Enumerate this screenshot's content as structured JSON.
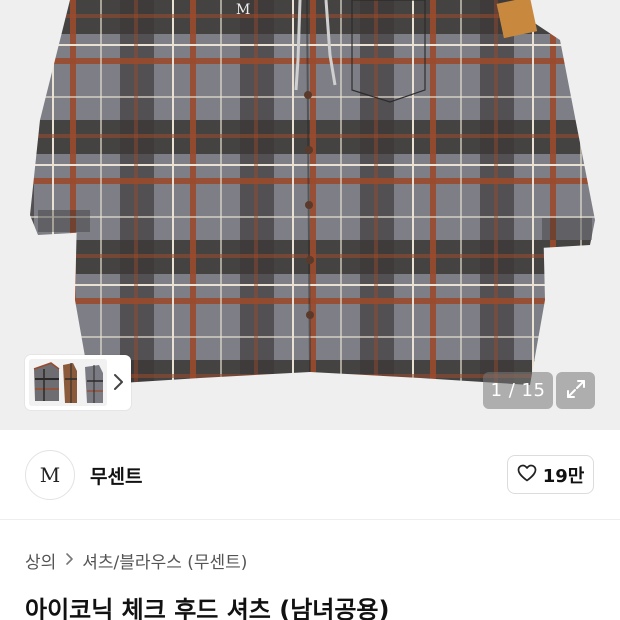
{
  "gallery": {
    "counter": "1 / 15",
    "thumbnail_icon": "shirt-thumbnail",
    "next_icon": "chevron-right-icon",
    "expand_icon": "expand-icon"
  },
  "store": {
    "logo_text": "M",
    "name": "무센트",
    "like_icon": "heart-icon",
    "like_count": "19만"
  },
  "breadcrumb": {
    "items": [
      "상의",
      "셔츠/블라우스 (무센트)"
    ],
    "separator_icon": "chevron-right-icon"
  },
  "product": {
    "title": "아이코닉 체크 후드 셔츠 (남녀공용)"
  },
  "colors": {
    "plaid_gray": "#7e7f86",
    "plaid_dark": "#2c2a28",
    "plaid_rust": "#9a4a2c",
    "plaid_cream": "#e9e2d4",
    "background": "#efefef"
  }
}
